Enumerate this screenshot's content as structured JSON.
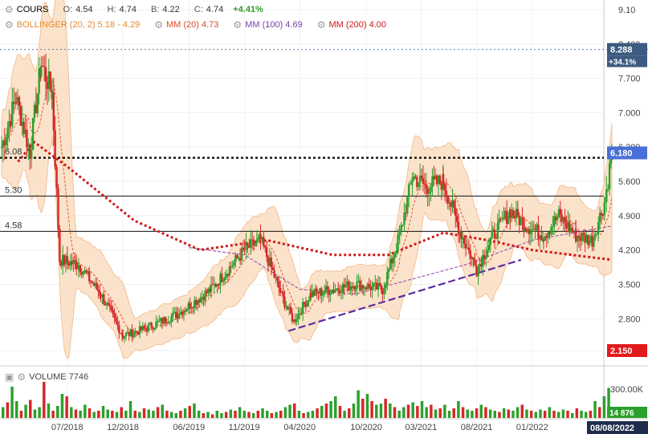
{
  "legend": {
    "instrument": "COURS",
    "open_label": "O:",
    "open": "4.54",
    "high_label": "H:",
    "high": "4.74",
    "low_label": "B:",
    "low": "4.22",
    "close_label": "C:",
    "close": "4.74",
    "change": "+4.41%",
    "bollinger_label": "BOLLINGER (20, 2) 5.18 - 4.29",
    "mm20_label": "MM (20) 4.73",
    "mm100_label": "MM (100) 4.69",
    "mm200_label": "MM (200) 4.00",
    "volume_label": "VOLUME 7746"
  },
  "colors": {
    "up": "#2ca02c",
    "down": "#d62728",
    "bollinger_fill": "#fbe0c6",
    "bollinger_edge": "#f5b98a",
    "mm20": "#e4572e",
    "mm100": "#8e44ad",
    "mm200": "#d11a1a",
    "trendline": "#5b2d9e",
    "accent_blue": "#4a6fd6",
    "last_price": "#2ca02c",
    "low_marker": "#e31a1c"
  },
  "chart_data": {
    "type": "candlestick",
    "y_ticks": [
      "9.10",
      "8.400",
      "7.700",
      "7.000",
      "6.300",
      "5.600",
      "4.900",
      "4.200",
      "3.500",
      "2.800",
      "2.150"
    ],
    "ylim": [
      2.15,
      9.1
    ],
    "x_ticks": [
      "07/2018",
      "12/2018",
      "06/2019",
      "11/2019",
      "04/2020",
      "10/2020",
      "03/2021",
      "08/2021",
      "01/2022"
    ],
    "x_date_range": [
      "2018-01-01",
      "2022-08-08"
    ],
    "last_date": "08/08/2022",
    "annotations": {
      "price_boxes": [
        {
          "text": "8.288",
          "value": 8.288,
          "note": "+34.1%"
        },
        {
          "text": "6.180",
          "value": 6.18
        },
        {
          "text": "2.150",
          "value": 2.15
        }
      ],
      "horizontal_levels": [
        {
          "label": "6.08",
          "value": 6.08,
          "style": "dotted"
        },
        {
          "label": "5.30",
          "value": 5.3,
          "style": "solid"
        },
        {
          "label": "4.58",
          "value": 4.58,
          "style": "solid"
        }
      ],
      "dashed_level": 8.288
    },
    "candle_anchors": [
      {
        "date": "2018-01-01",
        "close": 6.3
      },
      {
        "date": "2018-02-10",
        "close": 7.3
      },
      {
        "date": "2018-03-20",
        "close": 6.2
      },
      {
        "date": "2018-04-20",
        "close": 8.0
      },
      {
        "date": "2018-05-20",
        "close": 7.4
      },
      {
        "date": "2018-06-10",
        "close": 4.0
      },
      {
        "date": "2018-08-01",
        "close": 3.9
      },
      {
        "date": "2018-10-01",
        "close": 3.3
      },
      {
        "date": "2018-12-01",
        "close": 2.45
      },
      {
        "date": "2019-02-01",
        "close": 2.6
      },
      {
        "date": "2019-05-01",
        "close": 2.9
      },
      {
        "date": "2019-08-01",
        "close": 3.4
      },
      {
        "date": "2019-11-01",
        "close": 4.2
      },
      {
        "date": "2019-12-15",
        "close": 4.4
      },
      {
        "date": "2020-02-15",
        "close": 3.2
      },
      {
        "date": "2020-03-15",
        "close": 2.75
      },
      {
        "date": "2020-05-01",
        "close": 3.3
      },
      {
        "date": "2020-09-01",
        "close": 3.5
      },
      {
        "date": "2020-11-15",
        "close": 3.4
      },
      {
        "date": "2021-01-01",
        "close": 4.5
      },
      {
        "date": "2021-02-05",
        "close": 5.7
      },
      {
        "date": "2021-03-15",
        "close": 5.5
      },
      {
        "date": "2021-05-01",
        "close": 5.6
      },
      {
        "date": "2021-06-15",
        "close": 4.6
      },
      {
        "date": "2021-08-01",
        "close": 3.8
      },
      {
        "date": "2021-09-15",
        "close": 4.5
      },
      {
        "date": "2021-11-01",
        "close": 5.0
      },
      {
        "date": "2021-12-15",
        "close": 4.7
      },
      {
        "date": "2022-02-01",
        "close": 4.5
      },
      {
        "date": "2022-03-15",
        "close": 4.9
      },
      {
        "date": "2022-05-01",
        "close": 4.5
      },
      {
        "date": "2022-06-15",
        "close": 4.4
      },
      {
        "date": "2022-07-20",
        "close": 5.2
      },
      {
        "date": "2022-08-08",
        "close": 6.18
      }
    ],
    "mm200_anchors": [
      {
        "date": "2018-02-15",
        "value": 6.0
      },
      {
        "date": "2018-04-01",
        "value": 6.4
      },
      {
        "date": "2018-07-01",
        "value": 5.9
      },
      {
        "date": "2019-01-01",
        "value": 4.8
      },
      {
        "date": "2019-07-01",
        "value": 4.2
      },
      {
        "date": "2020-01-01",
        "value": 4.4
      },
      {
        "date": "2020-07-01",
        "value": 4.1
      },
      {
        "date": "2020-12-01",
        "value": 4.1
      },
      {
        "date": "2021-05-01",
        "value": 4.55
      },
      {
        "date": "2021-09-01",
        "value": 4.4
      },
      {
        "date": "2022-01-01",
        "value": 4.2
      },
      {
        "date": "2022-08-08",
        "value": 4.0
      }
    ],
    "mm100_anchors": [
      {
        "date": "2019-06-01",
        "value": 4.25
      },
      {
        "date": "2019-11-01",
        "value": 4.1
      },
      {
        "date": "2020-04-01",
        "value": 3.4
      },
      {
        "date": "2020-09-01",
        "value": 3.3
      },
      {
        "date": "2021-02-01",
        "value": 3.6
      },
      {
        "date": "2021-07-01",
        "value": 3.9
      },
      {
        "date": "2022-01-01",
        "value": 4.4
      },
      {
        "date": "2022-08-08",
        "value": 4.69
      }
    ],
    "trendline": [
      {
        "date": "2020-03-01",
        "value": 2.55
      },
      {
        "date": "2021-12-01",
        "value": 4.0
      }
    ],
    "volume": {
      "ylabel_tick": "300.00K",
      "last_value_box": "14 876",
      "bars": [
        90,
        130,
        260,
        140,
        60,
        110,
        150,
        70,
        90,
        300,
        120,
        60,
        100,
        200,
        180,
        90,
        70,
        60,
        110,
        80,
        50,
        60,
        100,
        70,
        60,
        50,
        90,
        60,
        140,
        60,
        50,
        80,
        70,
        60,
        90,
        110,
        60,
        50,
        40,
        60,
        80,
        100,
        120,
        60,
        40,
        50,
        30,
        60,
        40,
        50,
        70,
        60,
        90,
        60,
        50,
        40,
        60,
        80,
        60,
        40,
        50,
        60,
        90,
        110,
        120,
        60,
        40,
        50,
        60,
        80,
        100,
        120,
        140,
        180,
        100,
        60,
        80,
        120,
        230,
        160,
        200,
        140,
        110,
        120,
        160,
        120,
        90,
        60,
        90,
        110,
        130,
        100,
        140,
        90,
        110,
        70,
        80,
        110,
        60,
        80,
        140,
        90,
        70,
        60,
        80,
        110,
        90,
        70,
        60,
        50,
        80,
        70,
        60,
        90,
        110,
        70,
        60,
        50,
        70,
        60,
        90,
        60,
        50,
        70,
        60,
        40,
        80,
        60,
        50,
        60,
        140,
        90,
        180,
        250
      ]
    }
  }
}
